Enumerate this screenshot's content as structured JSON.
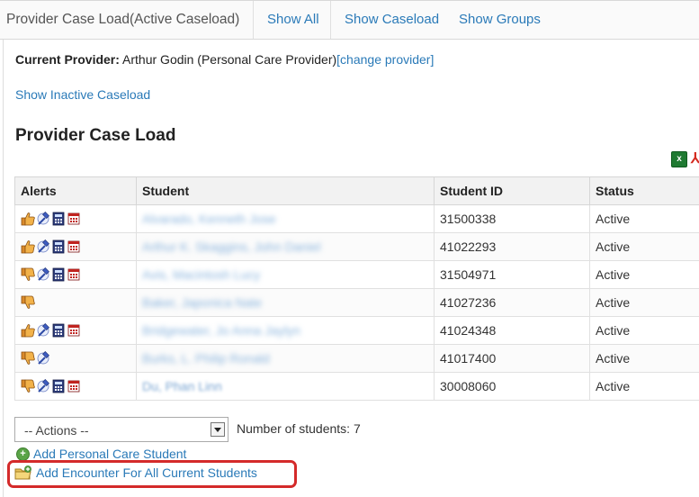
{
  "header": {
    "title": "Provider Case Load(Active Caseload)",
    "tabs": [
      {
        "label": "Show All"
      },
      {
        "label": "Show Caseload"
      },
      {
        "label": "Show Groups"
      }
    ]
  },
  "provider": {
    "label": "Current Provider:",
    "name": "Arthur Godin (Personal Care Provider)",
    "change_link": "[change provider]"
  },
  "show_inactive": "Show Inactive Caseload",
  "section_title": "Provider Case Load",
  "export": {
    "excel_icon": "excel-icon",
    "pdf_icon": "pdf-icon"
  },
  "table": {
    "headers": [
      "Alerts",
      "Student",
      "Student ID",
      "Status"
    ],
    "rows": [
      {
        "alerts": [
          "thumbs-up",
          "gavel",
          "calculator",
          "calendar"
        ],
        "student": "Alvarado, Kenneth Jose",
        "id": "31500338",
        "status": "Active"
      },
      {
        "alerts": [
          "thumbs-up",
          "gavel",
          "calculator",
          "calendar"
        ],
        "student": "Arthur K. Skaggins, John Daniel",
        "id": "41022293",
        "status": "Active"
      },
      {
        "alerts": [
          "thumbs-down",
          "gavel",
          "calculator",
          "calendar"
        ],
        "student": "Avis, Macintosh Lucy",
        "id": "31504971",
        "status": "Active"
      },
      {
        "alerts": [
          "thumbs-down"
        ],
        "student": "Baker, Japonica Nate",
        "id": "41027236",
        "status": "Active"
      },
      {
        "alerts": [
          "thumbs-up",
          "gavel",
          "calculator",
          "calendar"
        ],
        "student": "Bridgewater, Jo Anna Jaylyn",
        "id": "41024348",
        "status": "Active"
      },
      {
        "alerts": [
          "thumbs-down",
          "gavel"
        ],
        "student": "Burks, L. Philip Ronald",
        "id": "41017400",
        "status": "Active"
      },
      {
        "alerts": [
          "thumbs-down",
          "gavel",
          "calculator",
          "calendar"
        ],
        "student": "Du, Phan Linn",
        "id": "30008060",
        "status": "Active"
      }
    ]
  },
  "actions": {
    "selected": "-- Actions --",
    "count_label": "Number of students: 7"
  },
  "links": {
    "add_student": "Add Personal Care Student",
    "add_encounter": "Add Encounter For All Current Students"
  },
  "colors": {
    "link": "#2a7ab8",
    "highlight": "#d42a2a"
  }
}
